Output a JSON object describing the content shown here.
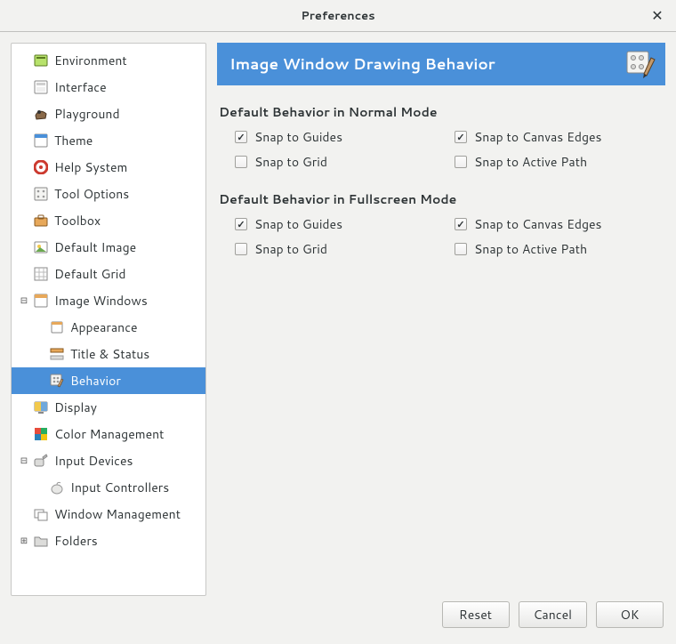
{
  "window": {
    "title": "Preferences"
  },
  "sidebar": {
    "items": [
      {
        "label": "Environment",
        "icon": "environment-icon",
        "depth": 0,
        "expander": "",
        "selected": false
      },
      {
        "label": "Interface",
        "icon": "interface-icon",
        "depth": 0,
        "expander": "",
        "selected": false
      },
      {
        "label": "Playground",
        "icon": "playground-icon",
        "depth": 0,
        "expander": "",
        "selected": false
      },
      {
        "label": "Theme",
        "icon": "theme-icon",
        "depth": 0,
        "expander": "",
        "selected": false
      },
      {
        "label": "Help System",
        "icon": "help-icon",
        "depth": 0,
        "expander": "",
        "selected": false
      },
      {
        "label": "Tool Options",
        "icon": "tool-options-icon",
        "depth": 0,
        "expander": "",
        "selected": false
      },
      {
        "label": "Toolbox",
        "icon": "toolbox-icon",
        "depth": 0,
        "expander": "",
        "selected": false
      },
      {
        "label": "Default Image",
        "icon": "default-image-icon",
        "depth": 0,
        "expander": "",
        "selected": false
      },
      {
        "label": "Default Grid",
        "icon": "default-grid-icon",
        "depth": 0,
        "expander": "",
        "selected": false
      },
      {
        "label": "Image Windows",
        "icon": "image-windows-icon",
        "depth": 0,
        "expander": "minus",
        "selected": false
      },
      {
        "label": "Appearance",
        "icon": "appearance-icon",
        "depth": 1,
        "expander": "",
        "selected": false
      },
      {
        "label": "Title & Status",
        "icon": "title-status-icon",
        "depth": 1,
        "expander": "",
        "selected": false
      },
      {
        "label": "Behavior",
        "icon": "behavior-icon",
        "depth": 1,
        "expander": "",
        "selected": true
      },
      {
        "label": "Display",
        "icon": "display-icon",
        "depth": 0,
        "expander": "",
        "selected": false
      },
      {
        "label": "Color Management",
        "icon": "color-mgmt-icon",
        "depth": 0,
        "expander": "",
        "selected": false
      },
      {
        "label": "Input Devices",
        "icon": "input-devices-icon",
        "depth": 0,
        "expander": "minus",
        "selected": false
      },
      {
        "label": "Input Controllers",
        "icon": "input-ctrl-icon",
        "depth": 1,
        "expander": "",
        "selected": false
      },
      {
        "label": "Window Management",
        "icon": "window-mgmt-icon",
        "depth": 0,
        "expander": "",
        "selected": false
      },
      {
        "label": "Folders",
        "icon": "folders-icon",
        "depth": 0,
        "expander": "plus",
        "selected": false
      }
    ]
  },
  "panel": {
    "header_title": "Image Window Drawing Behavior",
    "sections": [
      {
        "title": "Default Behavior in Normal Mode",
        "options": {
          "snap_guides": {
            "label": "Snap to Guides",
            "checked": true
          },
          "snap_grid": {
            "label": "Snap to Grid",
            "checked": false
          },
          "snap_edges": {
            "label": "Snap to Canvas Edges",
            "checked": true
          },
          "snap_path": {
            "label": "Snap to Active Path",
            "checked": false
          }
        }
      },
      {
        "title": "Default Behavior in Fullscreen Mode",
        "options": {
          "snap_guides": {
            "label": "Snap to Guides",
            "checked": true
          },
          "snap_grid": {
            "label": "Snap to Grid",
            "checked": false
          },
          "snap_edges": {
            "label": "Snap to Canvas Edges",
            "checked": true
          },
          "snap_path": {
            "label": "Snap to Active Path",
            "checked": false
          }
        }
      }
    ]
  },
  "buttons": {
    "reset": "Reset",
    "cancel": "Cancel",
    "ok": "OK"
  }
}
